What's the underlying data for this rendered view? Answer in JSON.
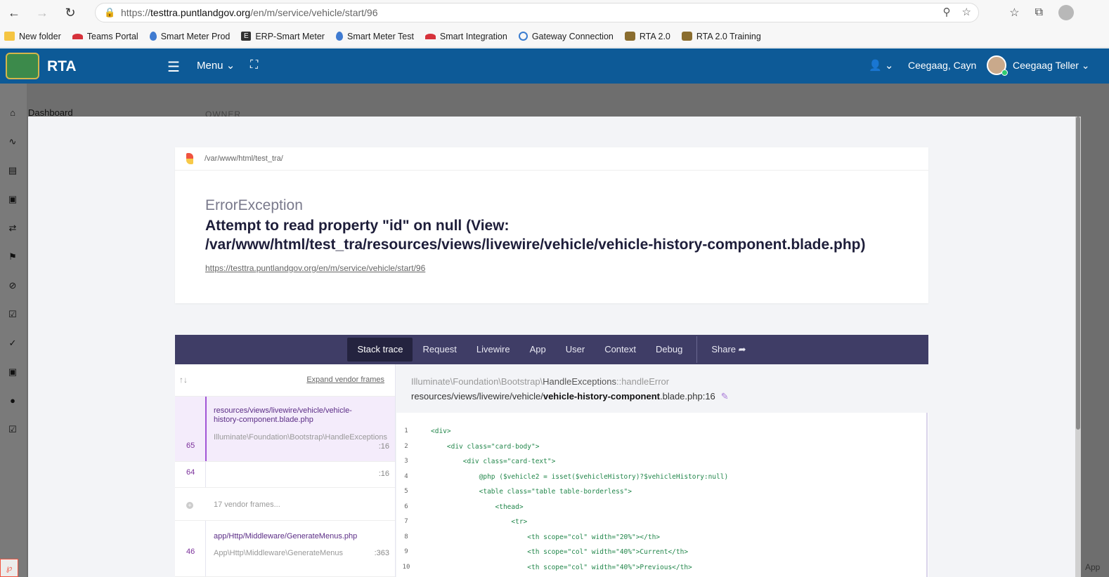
{
  "browser": {
    "url_prefix": "https://",
    "url_host": "testtra.puntlandgov.org",
    "url_path": "/en/m/service/vehicle/start/96",
    "bookmarks": [
      {
        "label": "New folder",
        "icon": "folder-icon"
      },
      {
        "label": "Teams Portal",
        "icon": "teams-icon"
      },
      {
        "label": "Smart Meter Prod",
        "icon": "drop-icon"
      },
      {
        "label": "ERP-Smart Meter",
        "icon": "e-icon"
      },
      {
        "label": "Smart Meter Test",
        "icon": "drop-icon"
      },
      {
        "label": "Smart Integration",
        "icon": "huawei-icon"
      },
      {
        "label": "Gateway Connection",
        "icon": "gateway-icon"
      },
      {
        "label": "RTA 2.0",
        "icon": "crest-icon"
      },
      {
        "label": "RTA 2.0 Training",
        "icon": "crest-icon"
      }
    ]
  },
  "header": {
    "app_name": "RTA",
    "menu_label": "Menu",
    "user_location": "Ceegaag, Cayn",
    "user_role": "Ceegaag Teller"
  },
  "background": {
    "sidebar_item": "Dashboard",
    "owner_label": "OWNER",
    "bottom_right_text": "App"
  },
  "error": {
    "path": "/var/www/html/test_tra/",
    "class": "ErrorException",
    "message": "Attempt to read property \"id\" on null (View: /var/www/html/test_tra/resources/views/livewire/vehicle/vehicle-history-component.blade.php)",
    "url": "https://testtra.puntlandgov.org/en/m/service/vehicle/start/96"
  },
  "tabs": [
    "Stack trace",
    "Request",
    "Livewire",
    "App",
    "User",
    "Context",
    "Debug"
  ],
  "share_label": "Share",
  "frames": {
    "expand_label": "Expand vendor frames",
    "items": [
      {
        "num": "65",
        "file": "resources/views/livewire/vehicle/vehicle-history-component.blade.php",
        "cls": "Illuminate\\Foundation\\Bootstrap\\HandleExceptions",
        "line": ":16"
      },
      {
        "num": "64",
        "file": "",
        "cls": "",
        "line": ":16"
      },
      {
        "vendor": "17 vendor frames..."
      },
      {
        "num": "46",
        "file": "app/Http/Middleware/GenerateMenus.php",
        "cls": "App\\Http\\Middleware\\GenerateMenus",
        "line": ":363"
      }
    ]
  },
  "code": {
    "ns_prefix": "Illuminate\\Foundation\\Bootstrap\\",
    "ns_class": "HandleExceptions",
    "ns_method": "::handleError",
    "file_prefix": "resources/views/livewire/vehicle/",
    "file_name": "vehicle-history-component",
    "file_suffix": ".blade.php:16",
    "line_numbers": [
      "1",
      "2",
      "3",
      "4",
      "5",
      "6",
      "7",
      "8",
      "9",
      "10"
    ],
    "lines": [
      "<div>",
      "    <div class=\"card-body\">",
      "        <div class=\"card-text\">",
      "            @php ($vehicle2 = isset($vehicleHistory)?$vehicleHistory:null)",
      "            <table class=\"table table-borderless\">",
      "                <thead>",
      "                    <tr>",
      "                        <th scope=\"col\" width=\"20%\"></th>",
      "                        <th scope=\"col\" width=\"40%\">Current</th>",
      "                        <th scope=\"col\" width=\"40%\">Previous</th>"
    ]
  }
}
